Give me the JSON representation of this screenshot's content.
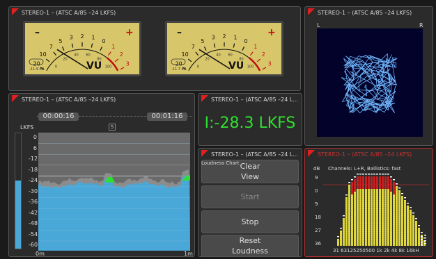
{
  "panels": {
    "vu": {
      "title": "STEREO-1 – (ATSC A/85 –24 LKFS)"
    },
    "lissajous": {
      "title": "STEREO-1 – (ATSC A/85 –24 LKFS)",
      "left_label": "L",
      "right_label": "R"
    },
    "loudness_chart": {
      "title": "STEREO-1 – (ATSC A/85 –24 LKFS)"
    },
    "loudness_value": {
      "title": "STEREO-1 – (ATSC A/85 –24 L..."
    },
    "controls": {
      "title": "STEREO-1 – (ATSC A/85 –24 L..."
    },
    "spectrum": {
      "title": "STEREO-1 – (ATSC A/85 –24 LKFS)"
    }
  },
  "vu_meters": [
    {
      "unit": "VU",
      "readout": "-11.9 dB",
      "scale_top": [
        "20",
        "10",
        "7",
        "5",
        "3",
        "2",
        "1",
        "0",
        "1",
        "2",
        "3"
      ],
      "scale_bottom": [
        "0",
        "20",
        "40",
        "60",
        "80",
        "100"
      ],
      "minus": "–",
      "plus": "+"
    },
    {
      "unit": "VU",
      "readout": "-11.7 dB",
      "scale_top": [
        "20",
        "10",
        "7",
        "5",
        "3",
        "2",
        "1",
        "0",
        "1",
        "2",
        "3"
      ],
      "scale_bottom": [
        "0",
        "20",
        "40",
        "60",
        "80",
        "100"
      ],
      "minus": "–",
      "plus": "+"
    }
  ],
  "loudness_chart": {
    "time_start": "00:00:16",
    "time_end": "00:01:16",
    "s_marker": "S",
    "y_unit": "LKFS",
    "y_ticks": [
      "0",
      "6",
      "12",
      "18",
      "24",
      "30",
      "36",
      "42",
      "48",
      "54",
      "60"
    ],
    "y_ticks_display": [
      "0",
      "6",
      "-12",
      "-18",
      "-24",
      "-30",
      "-36",
      "-42",
      "-48",
      "-54",
      "-60"
    ],
    "x_start": "0m",
    "x_end": "1m",
    "overlay_label": "Loudness Chart"
  },
  "loudness_value": {
    "prefix": "I:",
    "value": "-28.3",
    "unit": "LKFS"
  },
  "controls": {
    "clear_view": "Clear View",
    "start": "Start",
    "stop": "Stop",
    "reset_loudness": "Reset Loudness"
  },
  "spectrum": {
    "y_unit": "dB",
    "info": "Channels: L+R, Ballistics: fast",
    "y_ticks": [
      "9",
      "0",
      "9",
      "18",
      "27",
      "36"
    ],
    "x_labels": "31 63125250500 1k  2k  4k  8k 16kH"
  },
  "colors": {
    "panel_bg": "#2b2b2b",
    "accent_green": "#2ee02e",
    "flag_red": "#e02020",
    "chart_fill": "#4aa8d8",
    "bar_yellow": "#e8e040"
  }
}
